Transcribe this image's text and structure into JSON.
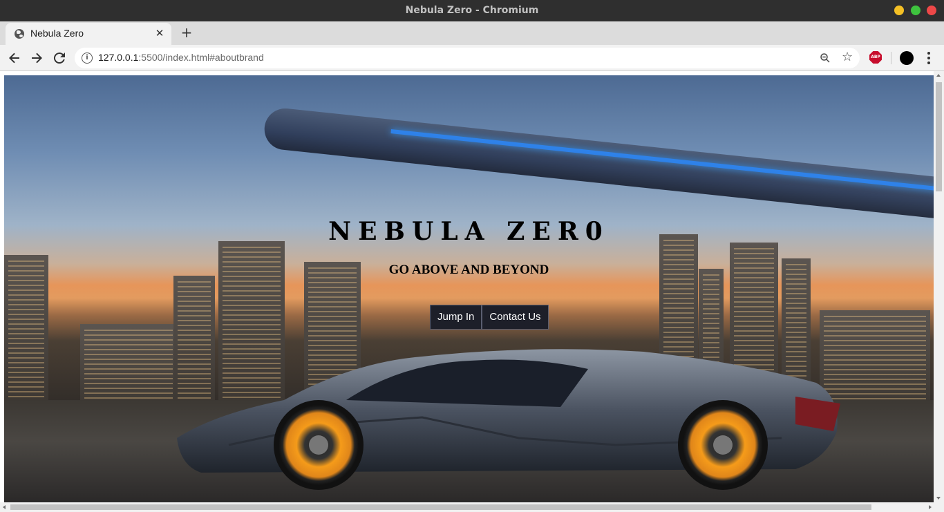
{
  "window": {
    "title": "Nebula Zero - Chromium"
  },
  "tabs": [
    {
      "label": "Nebula Zero",
      "icon": "globe-icon"
    }
  ],
  "omnibox": {
    "url_host": "127.0.0.1",
    "url_rest": ":5500/index.html#aboutbrand"
  },
  "extensions": {
    "abp_label": "ABP"
  },
  "hero": {
    "title": "NEBULA ZER0",
    "subtitle": "GO ABOVE AND BEYOND",
    "buttons": {
      "jump_in": "Jump In",
      "contact_us": "Contact Us"
    }
  },
  "colors": {
    "titlebar": "#2f2f2f",
    "button_bg": "#1d1f29",
    "minimize": "#f4c025",
    "maximize": "#3ec33e",
    "close": "#ee4848",
    "abp": "#c70d2c"
  }
}
